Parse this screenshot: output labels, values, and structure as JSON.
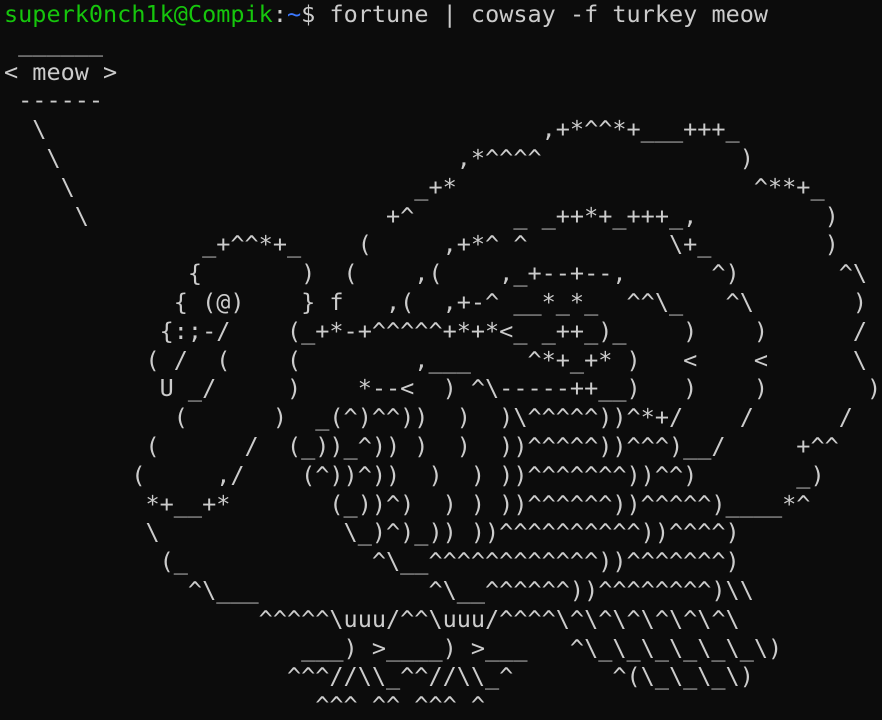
{
  "terminal": {
    "prompt_user": "superk0nch1k@Compik",
    "prompt_colon": ":",
    "prompt_path": "~",
    "prompt_dollar": "$ ",
    "command": "fortune | cowsay -f turkey meow",
    "output_lines": [
      " ______",
      "< meow >",
      " ------",
      "  \\                                   ,+*^^*+___+++_",
      "   \\                            ,*^^^^              )",
      "    \\                        _+*                     ^**+_",
      "     \\                     +^       _ _++*+_+++_,         )",
      "              _+^^*+_    (     ,+*^ ^          \\+_        )",
      "             {       )  (    ,(    ,_+--+--,      ^)       ^\\",
      "            { (@)    } f   ,(  ,+-^ __*_*_  ^^\\_   ^\\       )",
      "           {:;-/    (_+*-+^^^^^+*+*<_ _++_)_    )    )      /",
      "          ( /  (    (        ,___    ^*+_+* )   <    <      \\",
      "           U _/     )    *--<  ) ^\\-----++__)   )    )       )",
      "            (      )  _(^)^^))  )  )\\^^^^^))^*+/    /      /",
      "          (      /  (_))_^)) )  )  ))^^^^^))^^^)__/     +^^",
      "         (     ,/    (^))^))  )  ) ))^^^^^^^))^^)       _)",
      "          *+__+*       (_))^)  ) ) ))^^^^^^))^^^^^)____*^",
      "          \\             \\_)^)_)) ))^^^^^^^^^^))^^^^)",
      "           (_             ^\\__^^^^^^^^^^^^))^^^^^^^)",
      "             ^\\___            ^\\__^^^^^^))^^^^^^^^)\\\\",
      "                  ^^^^^\\uuu/^^\\uuu/^^^^\\^\\^\\^\\^\\^\\^\\",
      "                     ___) >____) >___   ^\\_\\_\\_\\_\\_\\_\\)",
      "                    ^^^//\\\\_^^//\\\\_^       ^(\\_\\_\\_\\)",
      "                      ^^^ ^^ ^^^ ^"
    ]
  }
}
